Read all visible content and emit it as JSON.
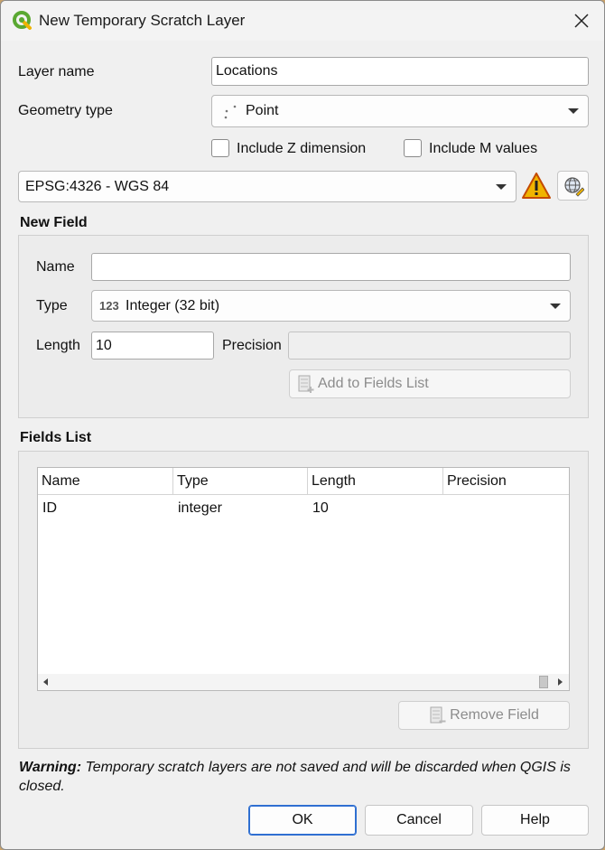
{
  "window": {
    "title": "New Temporary Scratch Layer"
  },
  "layer": {
    "name_label": "Layer name",
    "name_value": "Locations",
    "geometry_label": "Geometry type",
    "geometry_value": "Point",
    "include_z_label": "Include Z dimension",
    "include_z_checked": false,
    "include_m_label": "Include M values",
    "include_m_checked": false,
    "crs_value": "EPSG:4326 - WGS 84"
  },
  "new_field": {
    "title": "New Field",
    "name_label": "Name",
    "name_value": "",
    "type_label": "Type",
    "type_prefix": "123",
    "type_value": "Integer (32 bit)",
    "length_label": "Length",
    "length_value": "10",
    "precision_label": "Precision",
    "precision_value": "",
    "add_button": "Add to Fields List"
  },
  "fields_list": {
    "title": "Fields List",
    "columns": [
      "Name",
      "Type",
      "Length",
      "Precision"
    ],
    "rows": [
      {
        "name": "ID",
        "type": "integer",
        "length": "10",
        "precision": ""
      }
    ],
    "remove_button": "Remove Field"
  },
  "warning": {
    "prefix": "Warning:",
    "text": " Temporary scratch layers are not saved and will be discarded when QGIS is closed."
  },
  "buttons": {
    "ok": "OK",
    "cancel": "Cancel",
    "help": "Help"
  },
  "colors": {
    "accent": "#2f6fd1",
    "warning": "#f0b400",
    "qgis_green": "#5aa832"
  }
}
